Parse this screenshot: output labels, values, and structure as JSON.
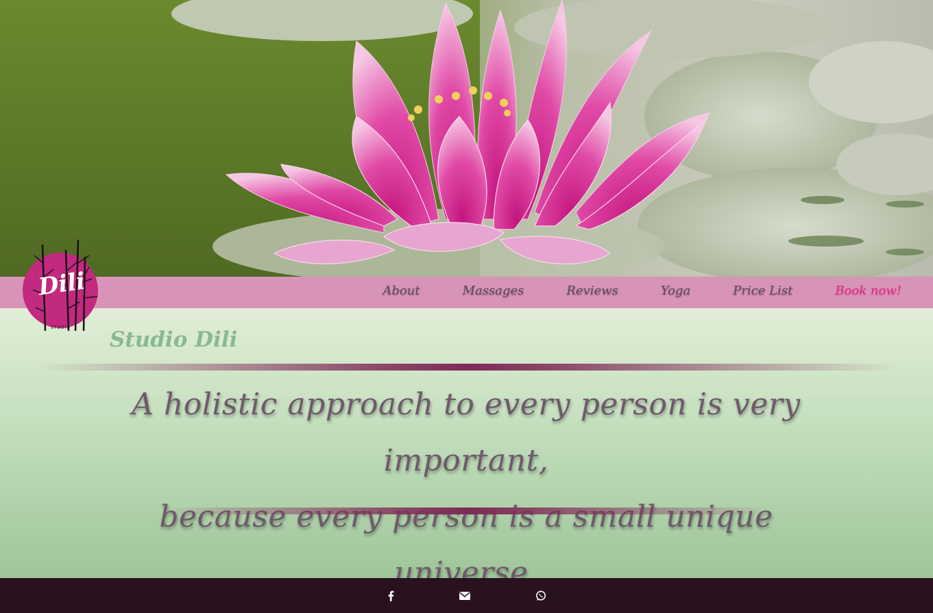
{
  "hero": {
    "image_description": "Pink water lily flower floating among lily pads on green pond water"
  },
  "logo": {
    "text": "Dili",
    "subtext": "STUDIO",
    "color": "#c12a7e"
  },
  "nav": {
    "items": [
      {
        "label": "About"
      },
      {
        "label": "Massages"
      },
      {
        "label": "Reviews"
      },
      {
        "label": "Yoga"
      },
      {
        "label": "Price List"
      },
      {
        "label": "Book now!",
        "highlight": true
      }
    ],
    "background": "#d894b8",
    "accent": "#e6287f"
  },
  "main": {
    "title": "Studio Dili",
    "quote_line1": "A holistic approach to every person is very important,",
    "quote_line2": "because every person is a small unique universe."
  },
  "footer": {
    "background": "#29121f",
    "social": [
      {
        "icon": "facebook-icon"
      },
      {
        "icon": "envelope-icon"
      },
      {
        "icon": "whatsapp-icon"
      }
    ]
  }
}
